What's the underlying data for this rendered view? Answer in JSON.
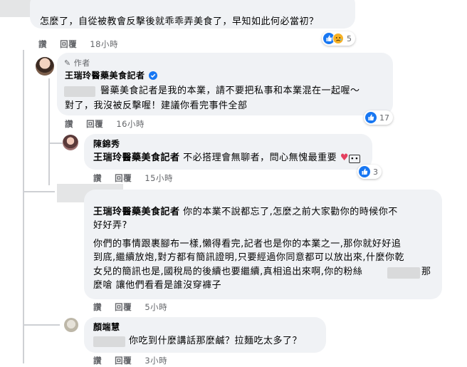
{
  "comments": [
    {
      "text": "怎麼了，自從被教會反擊後就乖乖弄美食了，早知如此何必當初？",
      "like": "讚",
      "reply": "回覆",
      "time": "18小時",
      "reaction_count": "5",
      "reactions": [
        "like-icon",
        "sad-icon"
      ]
    },
    {
      "author_badge": "作者",
      "author": "王瑞玲醫藥美食記者",
      "verified_icon": "verified-badge-icon",
      "line1": "醫藥美食記者是我的本業，請不要把私事和本業混在一起喔～",
      "line2": "對了，我沒被反擊喔！建議你看完事件全部",
      "like": "讚",
      "reply": "回覆",
      "time": "16小時",
      "reaction_count": "17",
      "reactions": [
        "like-icon"
      ]
    },
    {
      "author": "陳錦秀",
      "mention": "王瑞玲醫藥美食記者",
      "text": "不必搭理會無聊者，問心無愧最重要",
      "like": "讚",
      "reply": "回覆",
      "time": "15小時",
      "reaction_count": "3",
      "reactions": [
        "like-icon"
      ]
    },
    {
      "mention": "王瑞玲醫藥美食記者",
      "line1": "你的本業不說都忘了,怎麼之前大家勸你的時候你不",
      "line2": "好好弄?",
      "para_line1": "你們的事情跟裹腳布一樣,懶得看完,記者也是你的本業之一,那你就好好追",
      "para_line2": "到底,繼續放炮,對方都有簡訊證明,只要經過你同意都可以放出來,什麼你乾",
      "para_line3": "女兒的簡訊也是,國稅局的後續也要繼續,真相追出來啊,你的粉絲",
      "para_line3_end": "那",
      "para_line4": "麼嗆 讓他們看看是誰沒穿褲子",
      "like": "讚",
      "reply": "回覆",
      "time": "5小時"
    },
    {
      "author": "顏端慧",
      "text": "你吃到什麼講話那麼鹹？拉麵吃太多了？",
      "like": "讚",
      "reply": "回覆",
      "time": "3小時"
    }
  ],
  "colors": {
    "bubble": "#f0f2f5",
    "meta": "#65676b",
    "like_blue": "#1877f2",
    "sad_yellow": "#f7b125",
    "heart_red": "#e4405f"
  }
}
